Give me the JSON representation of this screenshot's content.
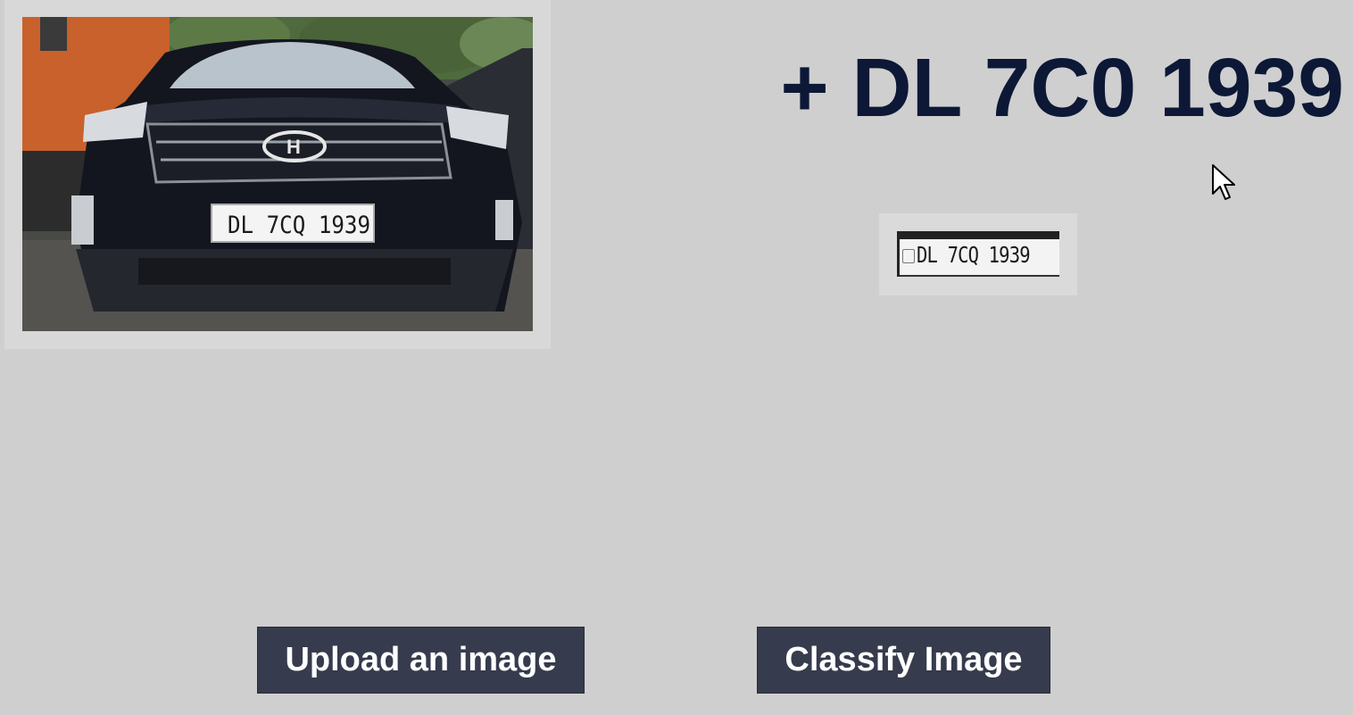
{
  "prediction": {
    "text": "+ DL 7C0 1939"
  },
  "uploaded_image": {
    "plate_text": "DL 7CQ 1939"
  },
  "plate_crop": {
    "plate_text": "DL 7CQ 1939"
  },
  "buttons": {
    "upload_label": "Upload an image",
    "classify_label": "Classify Image"
  },
  "colors": {
    "background": "#cfcfcf",
    "button_bg": "#363b4d",
    "button_text": "#ffffff",
    "prediction_text": "#0c1836"
  },
  "icons": {
    "cursor": "mouse-pointer-icon"
  }
}
